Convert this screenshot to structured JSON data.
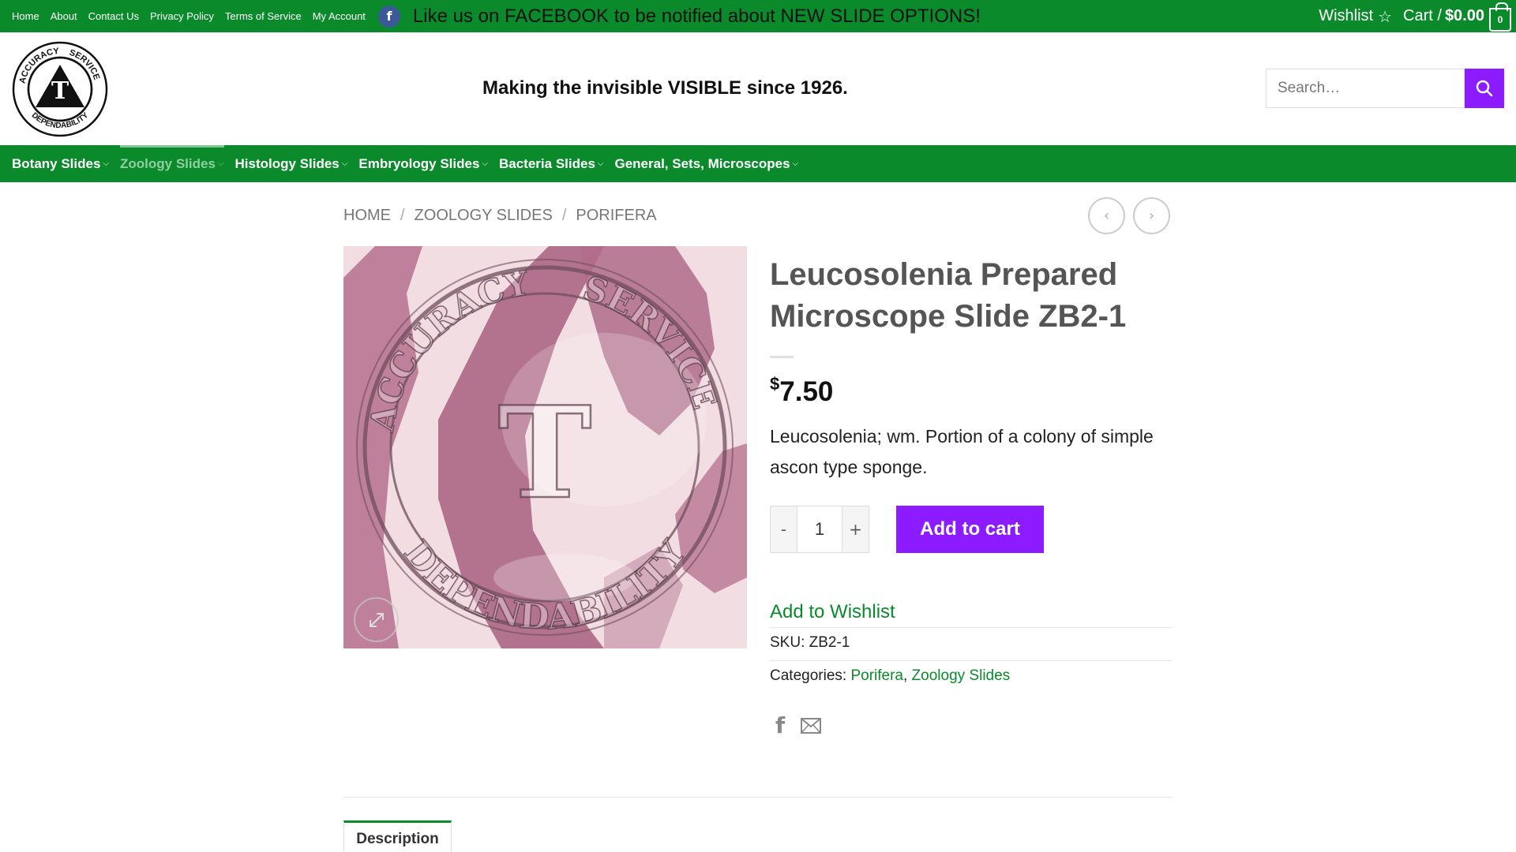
{
  "topbar": {
    "links": [
      "Home",
      "About",
      "Contact Us",
      "Privacy Policy",
      "Terms of Service",
      "My Account"
    ],
    "facebook_glyph": "f",
    "promo": "Like us on FACEBOOK to be notified about NEW SLIDE OPTIONS!",
    "wishlist": "Wishlist",
    "cart_label": "Cart /",
    "cart_total": "$0.00",
    "cart_count": "0"
  },
  "header": {
    "logo": {
      "top_arc_left": "ACCURACY",
      "top_arc_right": "SERVICE",
      "bottom_arc": "DEPENDABILITY",
      "letter": "T"
    },
    "tagline": "Making the invisible VISIBLE since 1926.",
    "search_placeholder": "Search…"
  },
  "mainnav": {
    "items": [
      "Botany Slides",
      "Zoology Slides",
      "Histology Slides",
      "Embryology Slides",
      "Bacteria Slides",
      "General, Sets, Microscopes"
    ],
    "active_index": 1
  },
  "breadcrumb": [
    "HOME",
    "ZOOLOGY SLIDES",
    "PORIFERA"
  ],
  "breadcrumb_sep": "/",
  "product": {
    "title": "Leucosolenia Prepared Microscope Slide ZB2-1",
    "currency": "$",
    "price": "7.50",
    "short_description": "Leucosolenia; wm. Portion of a colony of simple ascon type sponge.",
    "quantity": "1",
    "qty_minus": "-",
    "qty_plus": "+",
    "add_to_cart": "Add to cart",
    "add_to_wishlist": "Add to Wishlist",
    "sku_label": "SKU:",
    "sku": "ZB2-1",
    "categories_label": "Categories:",
    "categories": [
      "Porifera",
      "Zoology Slides"
    ],
    "image_watermark": {
      "top_left": "ACCURACY",
      "top_right": "SERVICE",
      "bottom": "DEPENDABILITY",
      "letter": "T"
    }
  },
  "tabs": [
    "Description"
  ],
  "colors": {
    "brand_green": "#0b8a2c",
    "accent_purple": "#8c1cff",
    "facebook_blue": "#3b5998"
  },
  "icons": [
    "facebook-icon",
    "star-icon",
    "cart-bag-icon",
    "search-icon",
    "chevron-down-icon",
    "chevron-left-icon",
    "chevron-right-icon",
    "expand-icon",
    "email-icon"
  ]
}
